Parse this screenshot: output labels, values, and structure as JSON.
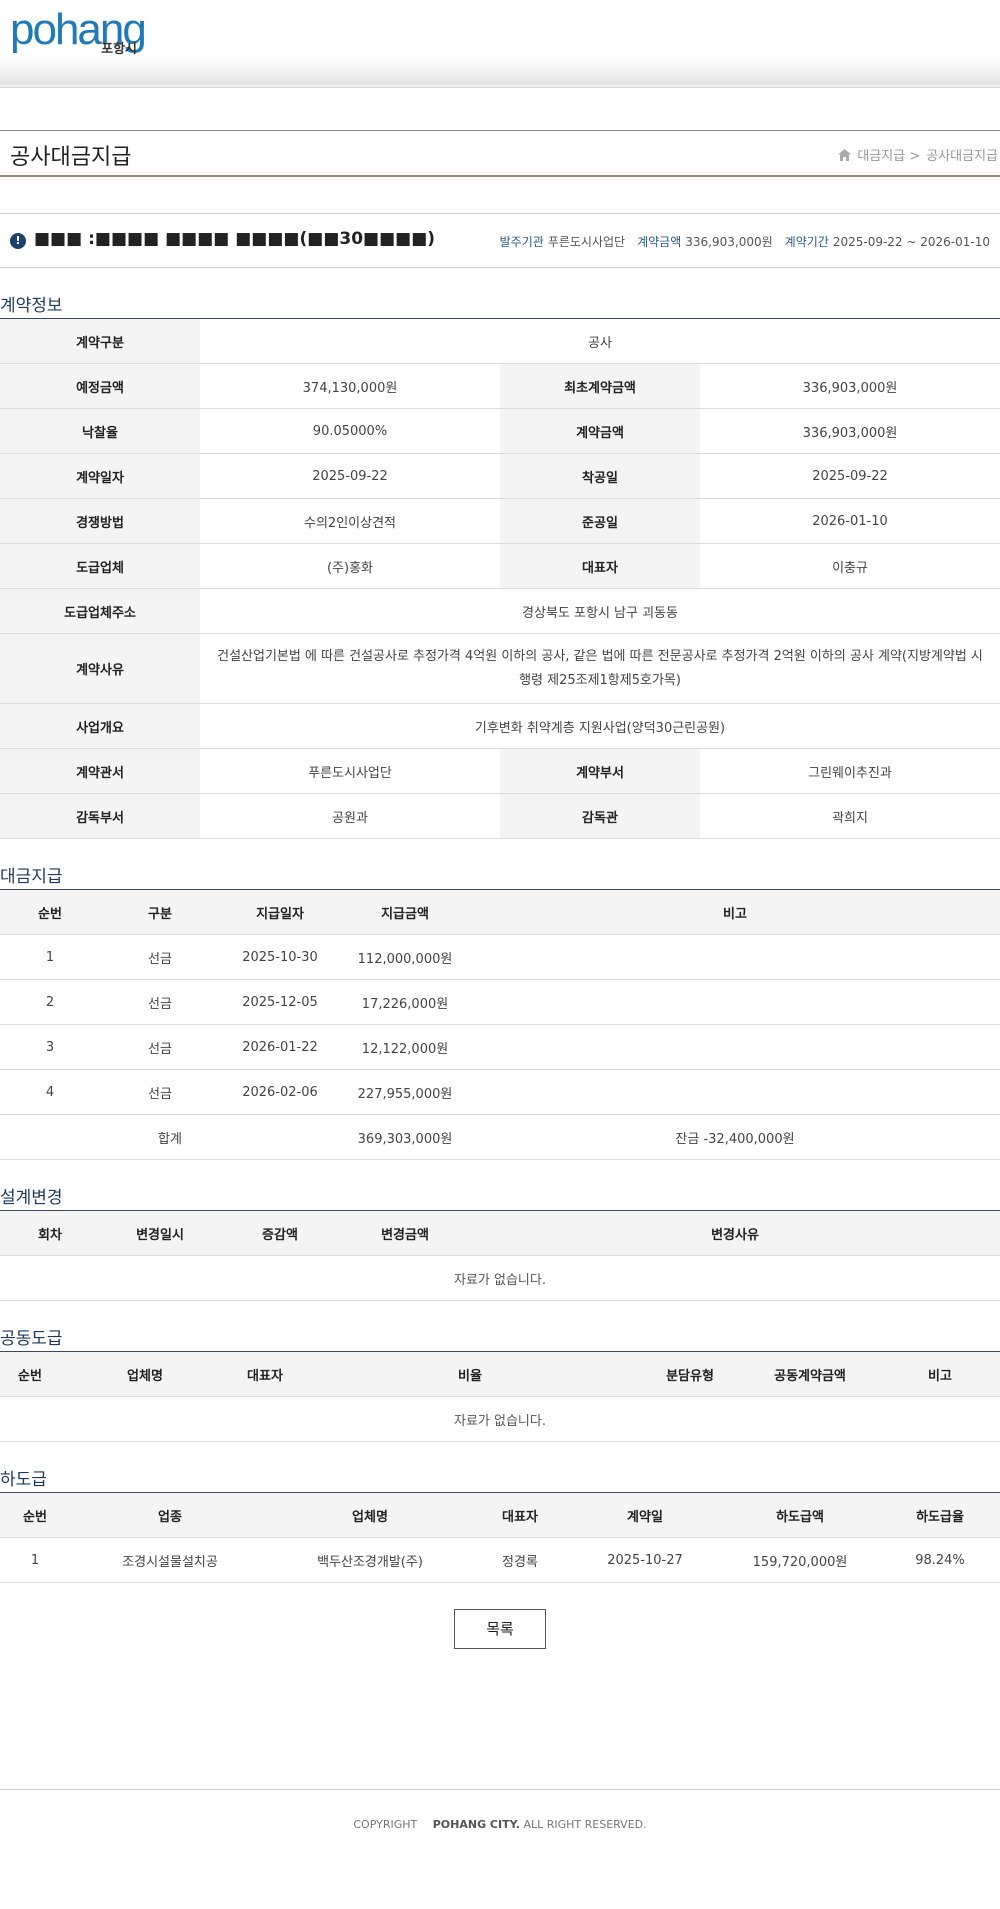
{
  "header": {
    "logo_text": "pohang",
    "logo_sub": "포항시"
  },
  "title_bar": {
    "title": "공사대금지급",
    "breadcrumb": [
      "대금지급 >",
      "공사대금지급"
    ]
  },
  "project": {
    "name": "■■■ :■■■■ ■■■■ ■■■■(■■30■■■■)",
    "meta": [
      {
        "label": "발주기관",
        "value": "푸른도시사업단"
      },
      {
        "label": "계약금액",
        "value": "336,903,000원"
      },
      {
        "label": "계약기간",
        "value": "2025-09-22 ~ 2026-01-10"
      }
    ]
  },
  "contract": {
    "section_title": "계약정보",
    "type_label": "계약구분",
    "type_value": "공사",
    "est_label": "예정금액",
    "est_value": "374,130,000원",
    "first_label": "최초계약금액",
    "first_value": "336,903,000원",
    "rate_label": "낙찰율",
    "rate_value": "90.05000%",
    "amount_label": "계약금액",
    "amount_value": "336,903,000원",
    "date_label": "계약일자",
    "date_value": "2025-09-22",
    "start_label": "착공일",
    "start_value": "2025-09-22",
    "method_label": "경쟁방법",
    "method_value": "수의2인이상견적",
    "end_label": "준공일",
    "end_value": "2026-01-10",
    "contractor_label": "도급업체",
    "contractor_value": "(주)홍화",
    "ceo_label": "대표자",
    "ceo_value": "이충규",
    "address_label": "도급업체주소",
    "address_value": "경상북도 포항시 남구 괴동동",
    "reason_label": "계약사유",
    "reason_value": "건설산업기본법    에 따른 건설공사로 추정가격 4억원 이하의 공사, 같은 법에 따른 전문공사로 추정가격 2억원 이하의 공사 계약(지방계약법 시행령 제25조제1항제5호가목)",
    "summary_label": "사업개요",
    "summary_value": "기후변화 취약계층 지원사업(양덕30근린공원)",
    "office_label": "계약관서",
    "office_value": "푸른도시사업단",
    "dept_label": "계약부서",
    "dept_value": "그린웨이추진과",
    "sup_dept_label": "감독부서",
    "sup_dept_value": "공원과",
    "supervisor_label": "감독관",
    "supervisor_value": "곽희지"
  },
  "payments": {
    "section_title": "대금지급",
    "headers": [
      "순번",
      "구분",
      "지급일자",
      "지급금액",
      "비고"
    ],
    "rows": [
      {
        "no": "1",
        "type": "선금",
        "date": "2025-10-30",
        "amount": "112,000,000원",
        "note": ""
      },
      {
        "no": "2",
        "type": "선금",
        "date": "2025-12-05",
        "amount": "17,226,000원",
        "note": ""
      },
      {
        "no": "3",
        "type": "선금",
        "date": "2026-01-22",
        "amount": "12,122,000원",
        "note": ""
      },
      {
        "no": "4",
        "type": "선금",
        "date": "2026-02-06",
        "amount": "227,955,000원",
        "note": ""
      }
    ],
    "total_label": "합계",
    "total_amount": "369,303,000원",
    "balance": "잔금 -32,400,000원"
  },
  "design_change": {
    "section_title": "설계변경",
    "headers": [
      "회차",
      "변경일시",
      "증감액",
      "변경금액",
      "변경사유"
    ],
    "empty": "자료가 없습니다."
  },
  "joint": {
    "section_title": "공동도급",
    "headers": [
      "순번",
      "업체명",
      "대표자",
      "비율",
      "분담유형",
      "공동계약금액",
      "비고"
    ],
    "empty": "자료가 없습니다."
  },
  "subcontract": {
    "section_title": "하도급",
    "headers": [
      "순번",
      "업종",
      "업체명",
      "대표자",
      "계약일",
      "하도급액",
      "하도급율"
    ],
    "rows": [
      {
        "no": "1",
        "industry": "조경시설물설치공",
        "company": "백두산조경개발(주)",
        "ceo": "정경록",
        "date": "2025-10-27",
        "amount": "159,720,000원",
        "rate": "98.24%"
      }
    ]
  },
  "buttons": {
    "list_label": "목록"
  },
  "footer": {
    "copyright": "COPYRIGHT",
    "org": "POHANG CITY.",
    "rights": "ALL RIGHT RESERVED."
  }
}
